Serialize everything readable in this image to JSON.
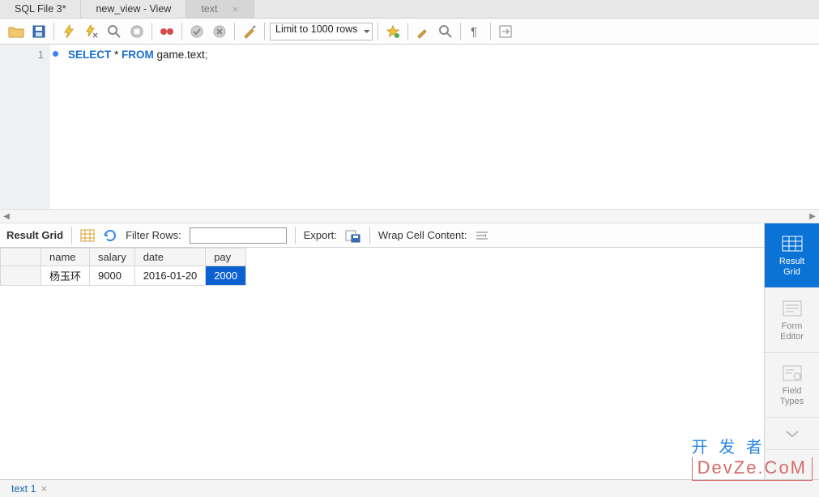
{
  "tabs": [
    {
      "label": "SQL File 3*"
    },
    {
      "label": "new_view - View"
    },
    {
      "label": "text",
      "active": true
    }
  ],
  "toolbar": {
    "limit_label": "Limit to 1000 rows"
  },
  "editor": {
    "line_number": "1",
    "sql_kw_select": "SELECT",
    "sql_star": " * ",
    "sql_kw_from": "FROM",
    "sql_ident": " game.text",
    "sql_semi": ";"
  },
  "result_toolbar": {
    "result_grid_label": "Result Grid",
    "filter_rows_label": "Filter Rows:",
    "filter_value": "",
    "export_label": "Export:",
    "wrap_label": "Wrap Cell Content:"
  },
  "table": {
    "columns": [
      "name",
      "salary",
      "date",
      "pay"
    ],
    "rows": [
      {
        "name": "杨玉环",
        "salary": "9000",
        "date": "2016-01-20",
        "pay": "2000",
        "selected_col": 3
      }
    ]
  },
  "side_panel": {
    "items": [
      {
        "label": "Result\nGrid",
        "active": true
      },
      {
        "label": "Form\nEditor"
      },
      {
        "label": "Field\nTypes"
      }
    ]
  },
  "bottom_tabs": [
    {
      "label": "text 1"
    }
  ],
  "watermark": {
    "cn": "开 发 者",
    "en": "DevZe.CoM"
  }
}
